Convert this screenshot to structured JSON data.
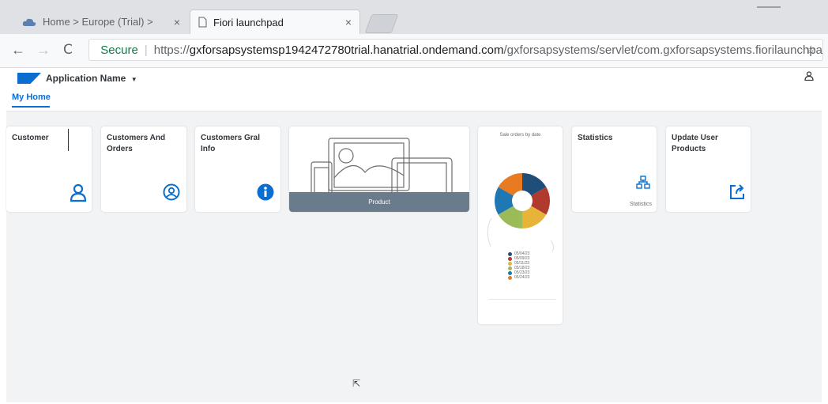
{
  "browser": {
    "tabs": [
      {
        "title": "Home > Europe (Trial) >",
        "close": "×"
      },
      {
        "title": "Fiori launchpad",
        "close": "×"
      }
    ],
    "nav": {
      "back": "←",
      "forward": "→",
      "reload": "C"
    },
    "address": {
      "secure_label": "Secure",
      "scheme": "https://",
      "host": "gxforsapsystemsp1942472780trial.hanatrial.ondemand.com",
      "path": "/gxforsapsystems/servlet/com.gxforsapsystems.fiorilaunchpa"
    }
  },
  "shell": {
    "app_name": "Application Name",
    "home_tab": "My Home"
  },
  "tiles": [
    {
      "title": "Customer",
      "icon": "user-outline-icon"
    },
    {
      "title": "Customers And Orders",
      "icon": "account-circle-icon"
    },
    {
      "title": "Customers Gral Info",
      "icon": "info-circle-icon"
    },
    {
      "title": "Product",
      "icon": "devices-illustration"
    },
    {
      "title": "Sale orders by date",
      "icon": "donut-chart"
    },
    {
      "title": "Statistics",
      "subtitle": "Statistics",
      "icon": "org-chart-icon"
    },
    {
      "title": "Update User Products",
      "icon": "share-box-icon"
    }
  ],
  "chart_data": {
    "type": "pie",
    "title": "Sale orders by date",
    "categories": [
      "05/04/23",
      "05/09/23",
      "05/11/23",
      "05/18/23",
      "05/23/23",
      "05/24/23"
    ],
    "colors": [
      "#1f4e79",
      "#b03a2e",
      "#e8b339",
      "#9bbb59",
      "#1f77b4",
      "#e87a22"
    ],
    "values": [
      1,
      1,
      1,
      1,
      1,
      1
    ]
  }
}
